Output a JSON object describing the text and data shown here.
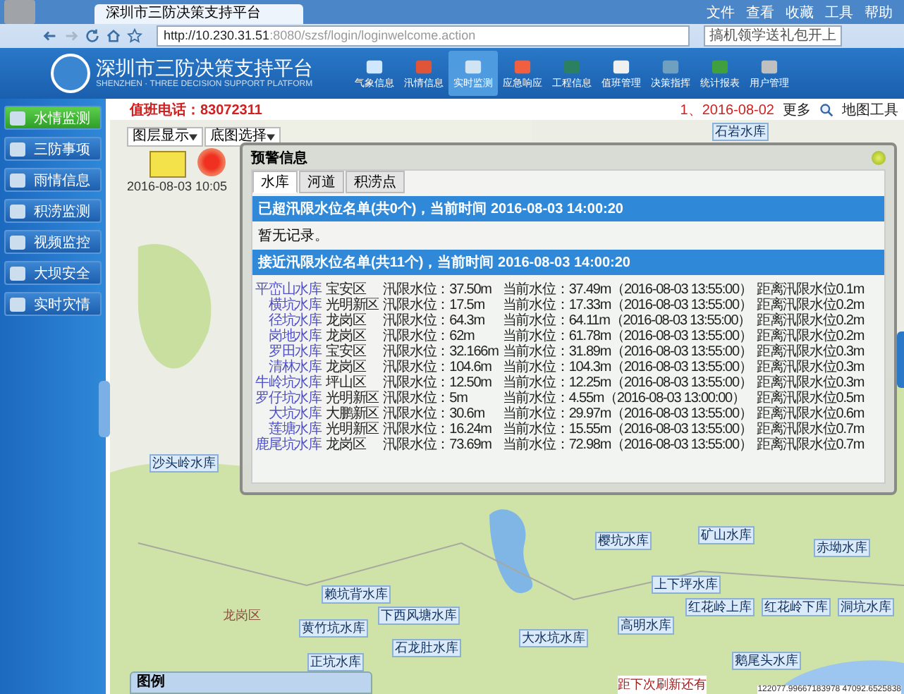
{
  "browser": {
    "tab_title": "深圳市三防决策支持平台",
    "url_host": "http://10.230.31.51",
    "url_path": ":8080/szsf/login/loginwelcome.action",
    "search_text": "搞机领学送礼包开上",
    "menu": [
      "文件",
      "查看",
      "收藏",
      "工具",
      "帮助"
    ]
  },
  "header": {
    "title": "深圳市三防决策支持平台",
    "subtitle": "SHENZHEN · THREE DECISION SUPPORT PLATFORM",
    "nav": [
      {
        "label": "气象信息",
        "selected": false
      },
      {
        "label": "汛情信息",
        "selected": false
      },
      {
        "label": "实时监测",
        "selected": true
      },
      {
        "label": "应急响应",
        "selected": false
      },
      {
        "label": "工程信息",
        "selected": false
      },
      {
        "label": "值班管理",
        "selected": false
      },
      {
        "label": "决策指挥",
        "selected": false
      },
      {
        "label": "统计报表",
        "selected": false
      },
      {
        "label": "用户管理",
        "selected": false
      }
    ]
  },
  "sidebar": [
    {
      "label": "水情监测",
      "selected": true
    },
    {
      "label": "三防事项",
      "selected": false
    },
    {
      "label": "雨情信息",
      "selected": false
    },
    {
      "label": "积涝监测",
      "selected": false
    },
    {
      "label": "视频监控",
      "selected": false
    },
    {
      "label": "大坝安全",
      "selected": false
    },
    {
      "label": "实时灾情",
      "selected": false
    }
  ],
  "top_strip": {
    "hotline": "值班电话：83072311",
    "notice": "1、2016-08-02",
    "more": "更多",
    "map_tools": "地图工具"
  },
  "map": {
    "layer_select": "图层显示",
    "basemap_select": "底图选择",
    "timestamp": "2016-08-03 10:05",
    "district_label": "龙岗区",
    "reservoirs": [
      {
        "name": "石岩水库"
      },
      {
        "name": "沙头岭水库"
      },
      {
        "name": "樱坑水库"
      },
      {
        "name": "矿山水库"
      },
      {
        "name": "赤坳水库"
      },
      {
        "name": "上下坪水库"
      },
      {
        "name": "红花岭上库"
      },
      {
        "name": "红花岭下库"
      },
      {
        "name": "洞坑水库"
      },
      {
        "name": "高明水库"
      },
      {
        "name": "大水坑水库"
      },
      {
        "name": "鹅尾头水库"
      },
      {
        "name": "赖坑背水库"
      },
      {
        "name": "下西风塘水库"
      },
      {
        "name": "黄竹坑水库"
      },
      {
        "name": "石龙肚水库"
      },
      {
        "name": "正坑水库"
      }
    ],
    "legend_title": "图例",
    "refresh_text": "距下次刷新还有",
    "coordinates": "122077.99667183978 47092.6525838"
  },
  "popup": {
    "title": "预警信息",
    "tabs": [
      {
        "label": "水库",
        "selected": true
      },
      {
        "label": "河道",
        "selected": false
      },
      {
        "label": "积涝点",
        "selected": false
      }
    ],
    "exceeded_banner": "已超汛限水位名单(共0个)，当前时间 2016-08-03 14:00:20",
    "no_record": "暂无记录。",
    "near_banner": "接近汛限水位名单(共11个)，当前时间 2016-08-03 14:00:20",
    "rows": [
      {
        "name": "平峦山水库",
        "district": "宝安区",
        "limit": "汛限水位：37.50m",
        "current": "当前水位：37.49m（2016-08-03 13:55:00）",
        "distance": "距离汛限水位0.1m"
      },
      {
        "name": "横坑水库",
        "district": "光明新区",
        "limit": "汛限水位：17.5m",
        "current": "当前水位：17.33m（2016-08-03 13:55:00）",
        "distance": "距离汛限水位0.2m"
      },
      {
        "name": "径坑水库",
        "district": "龙岗区",
        "limit": "汛限水位：64.3m",
        "current": "当前水位：64.11m（2016-08-03 13:55:00）",
        "distance": "距离汛限水位0.2m"
      },
      {
        "name": "岗地水库",
        "district": "龙岗区",
        "limit": "汛限水位：62m",
        "current": "当前水位：61.78m（2016-08-03 13:55:00）",
        "distance": "距离汛限水位0.2m"
      },
      {
        "name": "罗田水库",
        "district": "宝安区",
        "limit": "汛限水位：32.166m",
        "current": "当前水位：31.89m（2016-08-03 13:55:00）",
        "distance": "距离汛限水位0.3m"
      },
      {
        "name": "清林水库",
        "district": "龙岗区",
        "limit": "汛限水位：104.6m",
        "current": "当前水位：104.3m（2016-08-03 13:55:00）",
        "distance": "距离汛限水位0.3m"
      },
      {
        "name": "牛岭坑水库",
        "district": "坪山区",
        "limit": "汛限水位：12.50m",
        "current": "当前水位：12.25m（2016-08-03 13:55:00）",
        "distance": "距离汛限水位0.3m"
      },
      {
        "name": "罗仔坑水库",
        "district": "光明新区",
        "limit": "汛限水位：5m",
        "current": "当前水位：4.55m（2016-08-03 13:00:00）",
        "distance": "距离汛限水位0.5m"
      },
      {
        "name": "大坑水库",
        "district": "大鹏新区",
        "limit": "汛限水位：30.6m",
        "current": "当前水位：29.97m（2016-08-03 13:55:00）",
        "distance": "距离汛限水位0.6m"
      },
      {
        "name": "莲塘水库",
        "district": "光明新区",
        "limit": "汛限水位：16.24m",
        "current": "当前水位：15.55m（2016-08-03 13:55:00）",
        "distance": "距离汛限水位0.7m"
      },
      {
        "name": "鹿尾坑水库",
        "district": "龙岗区",
        "limit": "汛限水位：73.69m",
        "current": "当前水位：72.98m（2016-08-03 13:55:00）",
        "distance": "距离汛限水位0.7m"
      }
    ]
  }
}
